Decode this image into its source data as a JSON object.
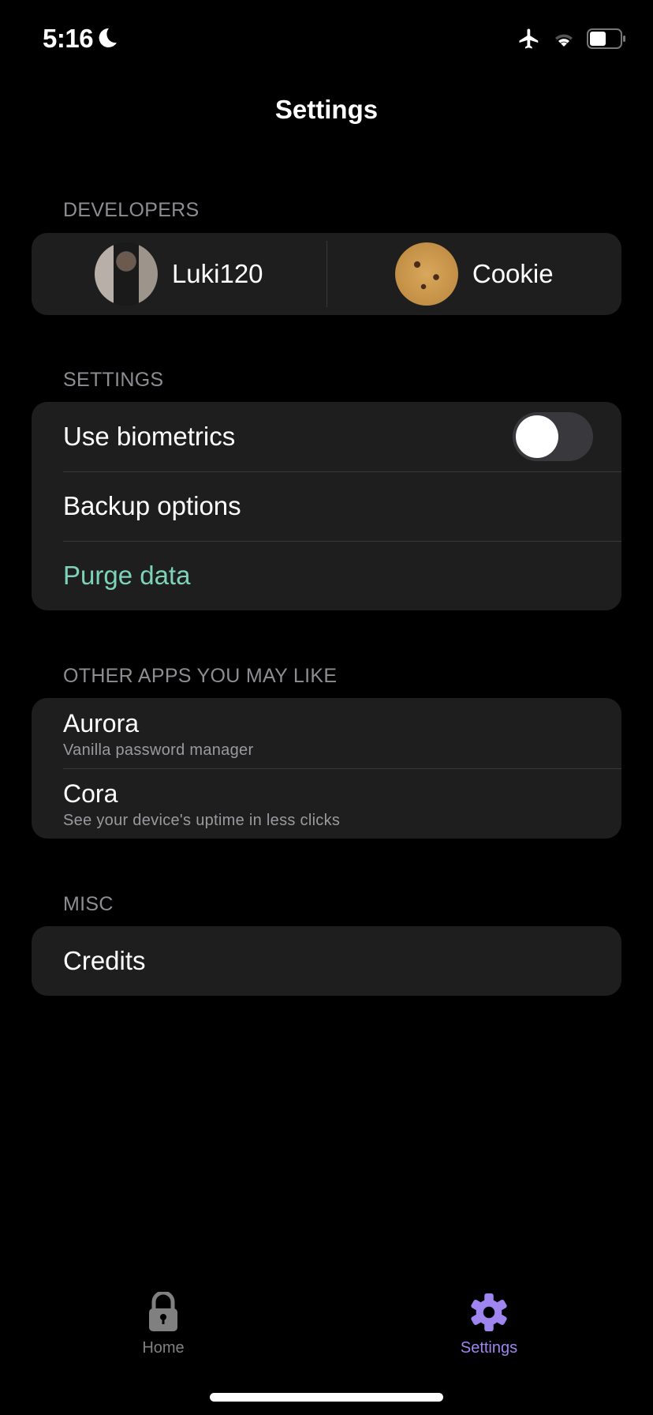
{
  "status_bar": {
    "time": "5:16"
  },
  "header": {
    "title": "Settings"
  },
  "developers": {
    "header": "DEVELOPERS",
    "items": [
      {
        "name": "Luki120"
      },
      {
        "name": "Cookie"
      }
    ]
  },
  "settings": {
    "header": "SETTINGS",
    "use_biometrics": "Use biometrics",
    "biometrics_enabled": false,
    "backup": "Backup options",
    "purge": "Purge data"
  },
  "other_apps": {
    "header": "OTHER APPS YOU MAY LIKE",
    "items": [
      {
        "name": "Aurora",
        "desc": "Vanilla password manager"
      },
      {
        "name": "Cora",
        "desc": "See your device's uptime in less clicks"
      }
    ]
  },
  "misc": {
    "header": "MISC",
    "credits": "Credits"
  },
  "tabbar": {
    "home": "Home",
    "settings": "Settings",
    "active": "settings"
  },
  "colors": {
    "accent": "#9f85f0",
    "destructive_teal": "#7dd3b8",
    "inactive": "#808080",
    "card": "#1e1e1e"
  }
}
